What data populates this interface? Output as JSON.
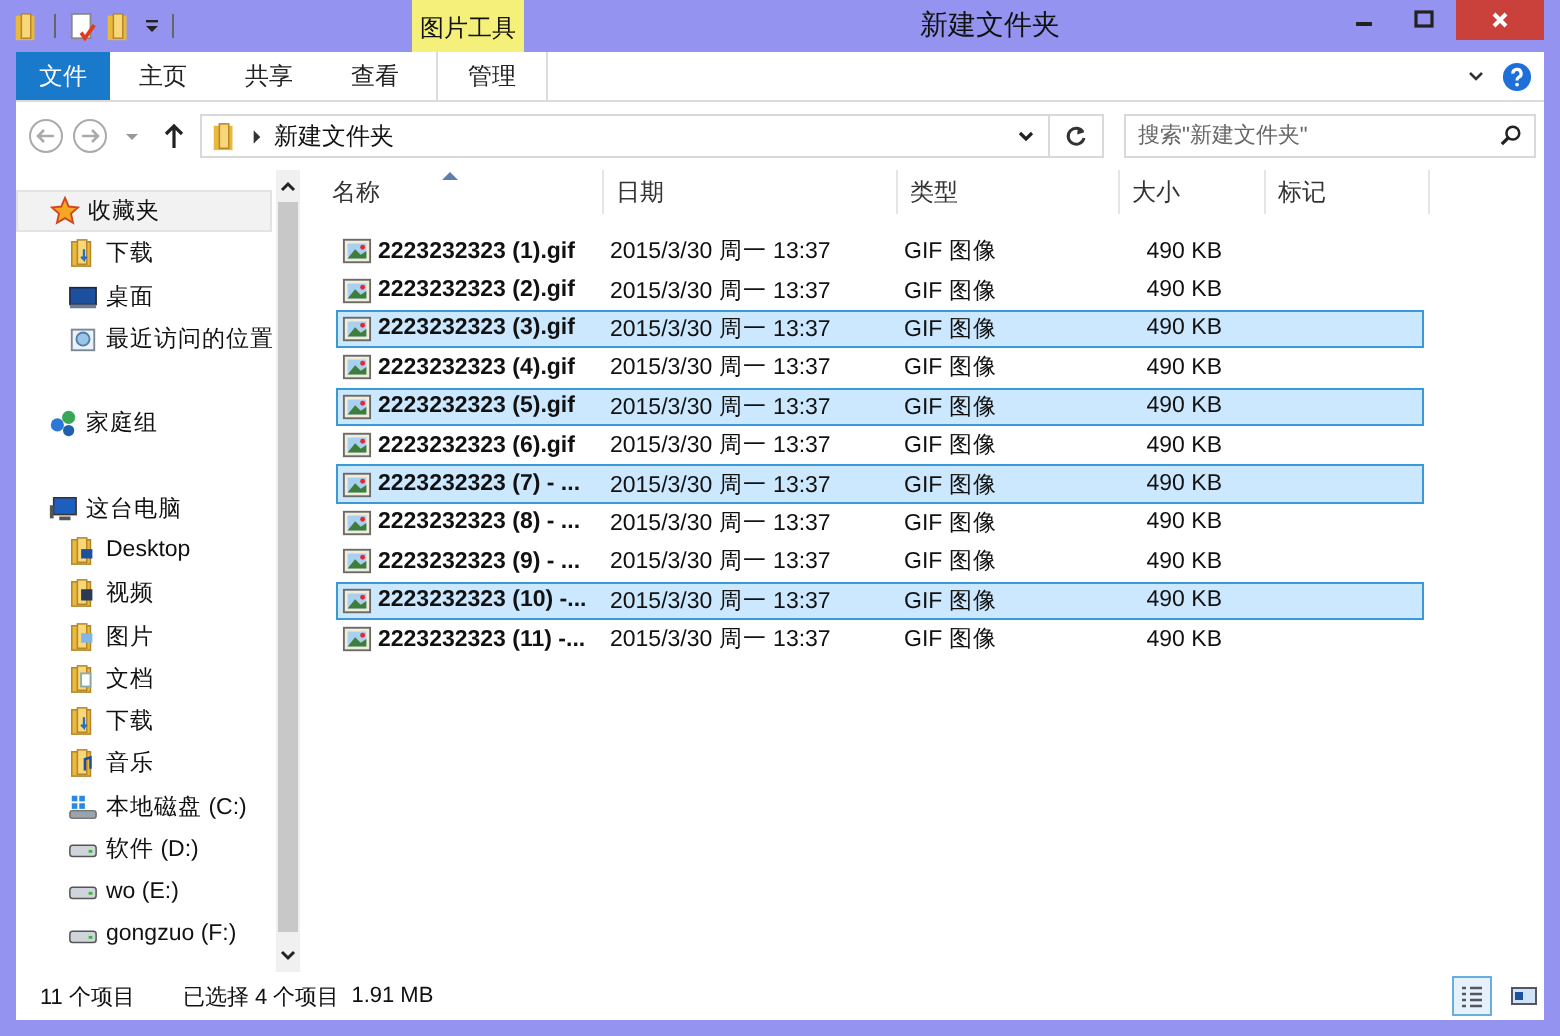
{
  "window": {
    "title": "新建文件夹",
    "context_tab": "图片工具"
  },
  "ribbon": {
    "file_tab": "文件",
    "tabs": [
      {
        "label": "主页",
        "context": false
      },
      {
        "label": "共享",
        "context": false
      },
      {
        "label": "查看",
        "context": false
      },
      {
        "label": "管理",
        "context": true
      }
    ]
  },
  "address": {
    "path": "新建文件夹"
  },
  "search": {
    "placeholder": "搜索\"新建文件夹\""
  },
  "sidebar": {
    "groups": [
      {
        "label": "收藏夹",
        "kind": "favorites",
        "selected": true,
        "children": [
          {
            "label": "下载",
            "kind": "download"
          },
          {
            "label": "桌面",
            "kind": "desktop"
          },
          {
            "label": "最近访问的位置",
            "kind": "recent"
          }
        ]
      },
      {
        "label": "家庭组",
        "kind": "homegroup",
        "selected": false
      },
      {
        "label": "这台电脑",
        "kind": "pc",
        "selected": false,
        "children": [
          {
            "label": "Desktop",
            "kind": "folder"
          },
          {
            "label": "视频",
            "kind": "video"
          },
          {
            "label": "图片",
            "kind": "pictures"
          },
          {
            "label": "文档",
            "kind": "docs"
          },
          {
            "label": "下载",
            "kind": "download"
          },
          {
            "label": "音乐",
            "kind": "music"
          },
          {
            "label": "本地磁盘 (C:)",
            "kind": "system-disk"
          },
          {
            "label": "软件 (D:)",
            "kind": "disk"
          },
          {
            "label": "wo (E:)",
            "kind": "disk"
          },
          {
            "label": "gongzuo (F:)",
            "kind": "disk"
          }
        ]
      }
    ]
  },
  "table": {
    "columns": [
      {
        "label": "名称",
        "sorted": true
      },
      {
        "label": "日期",
        "sorted": false
      },
      {
        "label": "类型",
        "sorted": false
      },
      {
        "label": "大小",
        "sorted": false
      },
      {
        "label": "标记",
        "sorted": false
      }
    ],
    "rows": [
      {
        "name": "2223232323 (1).gif",
        "date": "2015/3/30 周一 13:37",
        "type": "GIF 图像",
        "size": "490 KB",
        "selected": false
      },
      {
        "name": "2223232323 (2).gif",
        "date": "2015/3/30 周一 13:37",
        "type": "GIF 图像",
        "size": "490 KB",
        "selected": false
      },
      {
        "name": "2223232323 (3).gif",
        "date": "2015/3/30 周一 13:37",
        "type": "GIF 图像",
        "size": "490 KB",
        "selected": true
      },
      {
        "name": "2223232323 (4).gif",
        "date": "2015/3/30 周一 13:37",
        "type": "GIF 图像",
        "size": "490 KB",
        "selected": false
      },
      {
        "name": "2223232323 (5).gif",
        "date": "2015/3/30 周一 13:37",
        "type": "GIF 图像",
        "size": "490 KB",
        "selected": true
      },
      {
        "name": "2223232323 (6).gif",
        "date": "2015/3/30 周一 13:37",
        "type": "GIF 图像",
        "size": "490 KB",
        "selected": false
      },
      {
        "name": "2223232323 (7) - ...",
        "date": "2015/3/30 周一 13:37",
        "type": "GIF 图像",
        "size": "490 KB",
        "selected": true
      },
      {
        "name": "2223232323 (8) - ...",
        "date": "2015/3/30 周一 13:37",
        "type": "GIF 图像",
        "size": "490 KB",
        "selected": false
      },
      {
        "name": "2223232323 (9) - ...",
        "date": "2015/3/30 周一 13:37",
        "type": "GIF 图像",
        "size": "490 KB",
        "selected": false
      },
      {
        "name": "2223232323 (10) -...",
        "date": "2015/3/30 周一 13:37",
        "type": "GIF 图像",
        "size": "490 KB",
        "selected": true
      },
      {
        "name": "2223232323 (11) -...",
        "date": "2015/3/30 周一 13:37",
        "type": "GIF 图像",
        "size": "490 KB",
        "selected": false
      }
    ]
  },
  "status_bar": {
    "count": "11 个项目",
    "selection": "已选择 4 个项目",
    "selection_size": "1.91 MB",
    "views": [
      {
        "kind": "details",
        "selected": true
      },
      {
        "kind": "tiles",
        "selected": false
      }
    ]
  }
}
